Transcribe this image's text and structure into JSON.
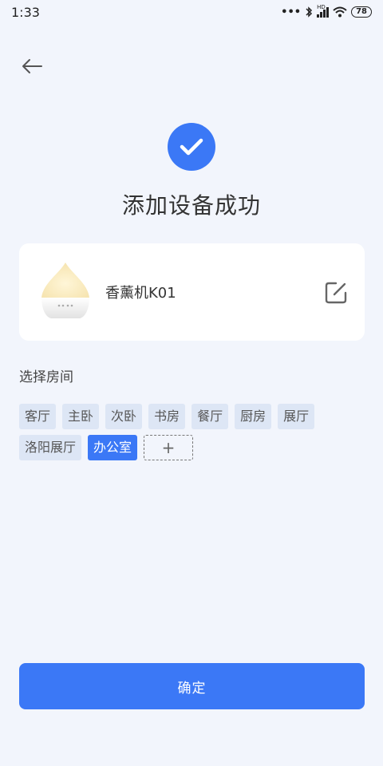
{
  "status_bar": {
    "time": "1:33",
    "signal_label": "HD",
    "battery": "78"
  },
  "header": {
    "back_icon": "arrow-left-icon"
  },
  "result": {
    "icon": "check-circle-icon",
    "title": "添加设备成功"
  },
  "device": {
    "name": "香薰机K01",
    "image": "aroma-diffuser-image",
    "edit_icon": "edit-icon"
  },
  "rooms": {
    "label": "选择房间",
    "items": [
      {
        "label": "客厅",
        "selected": false
      },
      {
        "label": "主卧",
        "selected": false
      },
      {
        "label": "次卧",
        "selected": false
      },
      {
        "label": "书房",
        "selected": false
      },
      {
        "label": "餐厅",
        "selected": false
      },
      {
        "label": "厨房",
        "selected": false
      },
      {
        "label": "展厅",
        "selected": false
      },
      {
        "label": "洛阳展厅",
        "selected": false
      },
      {
        "label": "办公室",
        "selected": true
      }
    ],
    "add_label": "+"
  },
  "footer": {
    "confirm_label": "确定"
  },
  "colors": {
    "accent": "#3b78f6",
    "background": "#f2f5fc",
    "chip": "#dde6f5"
  }
}
